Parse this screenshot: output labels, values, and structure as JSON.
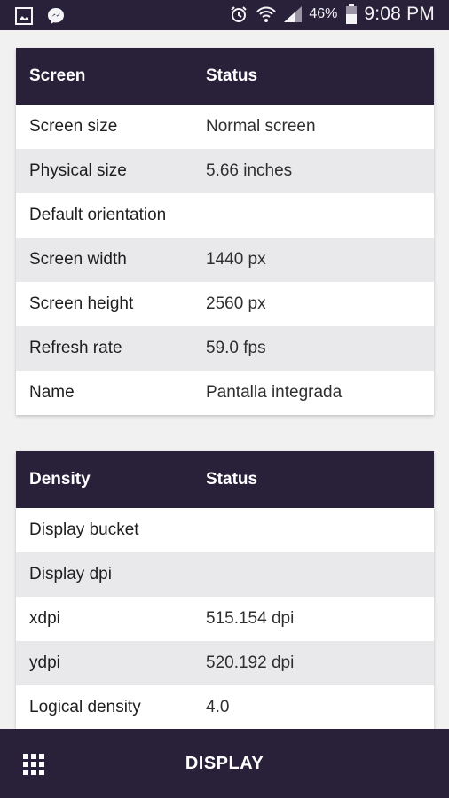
{
  "status_bar": {
    "left_icons": [
      "gallery-icon",
      "messenger-icon"
    ],
    "right_icons": [
      "alarm-icon",
      "wifi-icon",
      "signal-icon",
      "battery-icon"
    ],
    "battery": "46%",
    "time": "9:08 PM",
    "colors": {
      "background": "#29213a",
      "foreground": "#f4f4f6"
    }
  },
  "screen_table": {
    "headers": [
      "Screen",
      "Status"
    ],
    "rows": [
      [
        "Screen size",
        "Normal screen"
      ],
      [
        "Physical size",
        "5.66 inches"
      ],
      [
        "Default orientation",
        ""
      ],
      [
        "Screen width",
        "1440 px"
      ],
      [
        "Screen height",
        "2560 px"
      ],
      [
        "Refresh rate",
        "59.0 fps"
      ],
      [
        "Name",
        "Pantalla integrada"
      ]
    ]
  },
  "density_table": {
    "headers": [
      "Density",
      "Status"
    ],
    "rows": [
      [
        "Display bucket",
        ""
      ],
      [
        "Display dpi",
        ""
      ],
      [
        "xdpi",
        "515.154 dpi"
      ],
      [
        "ydpi",
        "520.192 dpi"
      ],
      [
        "Logical density",
        "4.0"
      ]
    ]
  },
  "bottom_bar": {
    "menu_icon": "apps-grid-icon",
    "title": "DISPLAY"
  },
  "colors": {
    "accent": "#29213a",
    "row_alt": "#e9e9ec",
    "page_background": "#f1f1f1"
  }
}
